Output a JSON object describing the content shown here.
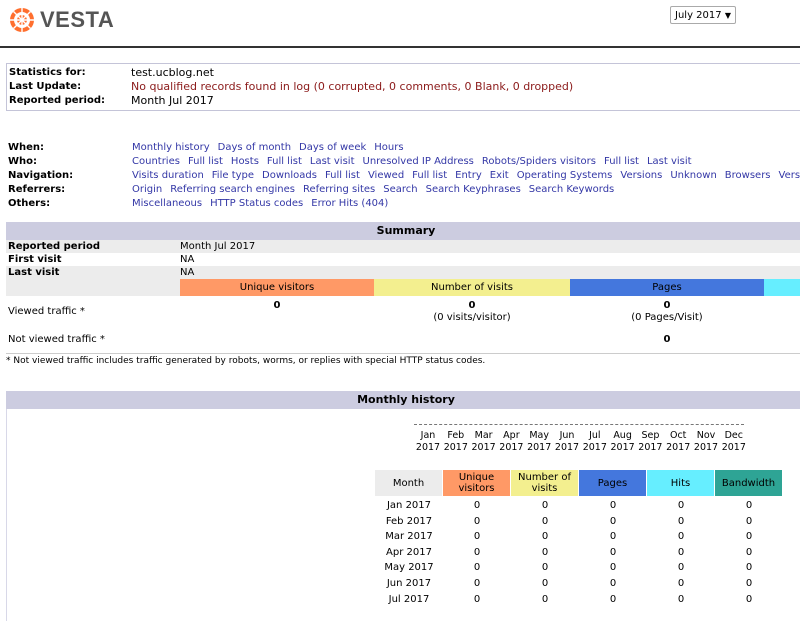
{
  "header": {
    "logo_text": "VESTA",
    "month_select": "July 2017"
  },
  "stats": {
    "for_label": "Statistics for:",
    "for_value": "test.ucblog.net",
    "update_label": "Last Update:",
    "update_value": "No qualified records found in log (0 corrupted, 0 comments, 0 Blank, 0 dropped)",
    "period_label": "Reported period:",
    "period_value": "Month Jul 2017"
  },
  "nav": [
    {
      "label": "When:",
      "links": [
        "Monthly history",
        "Days of month",
        "Days of week",
        "Hours"
      ]
    },
    {
      "label": "Who:",
      "links": [
        "Countries",
        "Full list",
        "Hosts",
        "Full list",
        "Last visit",
        "Unresolved IP Address",
        "Robots/Spiders visitors",
        "Full list",
        "Last visit"
      ]
    },
    {
      "label": "Navigation:",
      "links": [
        "Visits duration",
        "File type",
        "Downloads",
        "Full list",
        "Viewed",
        "Full list",
        "Entry",
        "Exit",
        "Operating Systems",
        "Versions",
        "Unknown",
        "Browsers",
        "Versions"
      ]
    },
    {
      "label": "Referrers:",
      "links": [
        "Origin",
        "Referring search engines",
        "Referring sites",
        "Search",
        "Search Keyphrases",
        "Search Keywords"
      ]
    },
    {
      "label": "Others:",
      "links": [
        "Miscellaneous",
        "HTTP Status codes",
        "Error Hits (404)"
      ]
    }
  ],
  "summary": {
    "title": "Summary",
    "period_label": "Reported period",
    "period_value": "Month Jul 2017",
    "first_label": "First visit",
    "first_value": "NA",
    "last_label": "Last visit",
    "last_value": "NA",
    "col_unique": "Unique visitors",
    "col_visits": "Number of visits",
    "col_pages": "Pages",
    "viewed_label": "Viewed traffic *",
    "viewed_unique": "0",
    "viewed_visits": "0",
    "viewed_visits_sub": "(0 visits/visitor)",
    "viewed_pages": "0",
    "viewed_pages_sub": "(0 Pages/Visit)",
    "notviewed_label": "Not viewed traffic *",
    "notviewed_pages": "0",
    "footnote": "* Not viewed traffic includes traffic generated by robots, worms, or replies with special HTTP status codes."
  },
  "monthly": {
    "title": "Monthly history",
    "chart_months": [
      "Jan",
      "Feb",
      "Mar",
      "Apr",
      "May",
      "Jun",
      "Jul",
      "Aug",
      "Sep",
      "Oct",
      "Nov",
      "Dec"
    ],
    "chart_year": "2017",
    "columns": [
      "Month",
      "Unique visitors",
      "Number of visits",
      "Pages",
      "Hits",
      "Bandwidth"
    ],
    "rows": [
      [
        "Jan 2017",
        "0",
        "0",
        "0",
        "0",
        "0"
      ],
      [
        "Feb 2017",
        "0",
        "0",
        "0",
        "0",
        "0"
      ],
      [
        "Mar 2017",
        "0",
        "0",
        "0",
        "0",
        "0"
      ],
      [
        "Apr 2017",
        "0",
        "0",
        "0",
        "0",
        "0"
      ],
      [
        "May 2017",
        "0",
        "0",
        "0",
        "0",
        "0"
      ],
      [
        "Jun 2017",
        "0",
        "0",
        "0",
        "0",
        "0"
      ],
      [
        "Jul 2017",
        "0",
        "0",
        "0",
        "0",
        "0"
      ]
    ]
  },
  "colors": {
    "unique": "#ff9966",
    "visits": "#f3ef8f",
    "pages": "#4477dd",
    "hits": "#66eeff",
    "bandwidth": "#2ea495",
    "month_header": "#ececec",
    "link": "#3337a6",
    "section": "#cccce0"
  }
}
